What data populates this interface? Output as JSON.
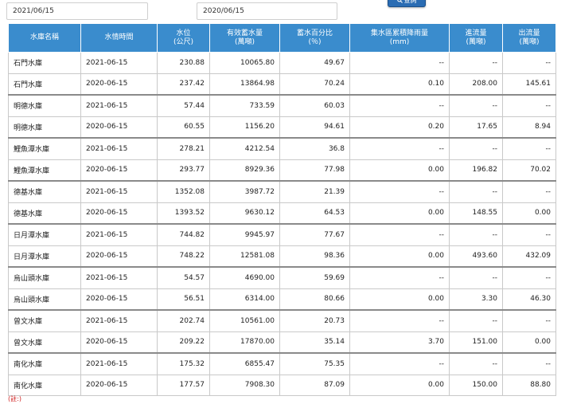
{
  "filters": {
    "date1": "2021/06/15",
    "date2": "2020/06/15"
  },
  "query_button": {
    "label": "查詢"
  },
  "table": {
    "headers": [
      [
        "水庫名稱"
      ],
      [
        "水情時間"
      ],
      [
        "水位",
        "(公尺)"
      ],
      [
        "有效蓄水量",
        "(萬噸)"
      ],
      [
        "蓄水百分比",
        "(％)"
      ],
      [
        "集水區累積降雨量",
        "(mm)"
      ],
      [
        "進流量",
        "(萬噸)"
      ],
      [
        "出流量",
        "(萬噸)"
      ]
    ],
    "rows": [
      [
        "石門水庫",
        "2021-06-15",
        "230.88",
        "10065.80",
        "49.67",
        "--",
        "--",
        "--"
      ],
      [
        "石門水庫",
        "2020-06-15",
        "237.42",
        "13864.98",
        "70.24",
        "0.10",
        "208.00",
        "145.61"
      ],
      [
        "明德水庫",
        "2021-06-15",
        "57.44",
        "733.59",
        "60.03",
        "--",
        "--",
        "--"
      ],
      [
        "明德水庫",
        "2020-06-15",
        "60.55",
        "1156.20",
        "94.61",
        "0.20",
        "17.65",
        "8.94"
      ],
      [
        "鯉魚潭水庫",
        "2021-06-15",
        "278.21",
        "4212.54",
        "36.8",
        "--",
        "--",
        "--"
      ],
      [
        "鯉魚潭水庫",
        "2020-06-15",
        "293.77",
        "8929.36",
        "77.98",
        "0.00",
        "196.82",
        "70.02"
      ],
      [
        "德基水庫",
        "2021-06-15",
        "1352.08",
        "3987.72",
        "21.39",
        "--",
        "--",
        "--"
      ],
      [
        "德基水庫",
        "2020-06-15",
        "1393.52",
        "9630.12",
        "64.53",
        "0.00",
        "148.55",
        "0.00"
      ],
      [
        "日月潭水庫",
        "2021-06-15",
        "744.82",
        "9945.97",
        "77.67",
        "--",
        "--",
        "--"
      ],
      [
        "日月潭水庫",
        "2020-06-15",
        "748.22",
        "12581.08",
        "98.36",
        "0.00",
        "493.60",
        "432.09"
      ],
      [
        "烏山頭水庫",
        "2021-06-15",
        "54.57",
        "4690.00",
        "59.69",
        "--",
        "--",
        "--"
      ],
      [
        "烏山頭水庫",
        "2020-06-15",
        "56.51",
        "6314.00",
        "80.66",
        "0.00",
        "3.30",
        "46.30"
      ],
      [
        "曾文水庫",
        "2021-06-15",
        "202.74",
        "10561.00",
        "20.73",
        "--",
        "--",
        "--"
      ],
      [
        "曾文水庫",
        "2020-06-15",
        "209.22",
        "17870.00",
        "35.14",
        "3.70",
        "151.00",
        "0.00"
      ],
      [
        "南化水庫",
        "2021-06-15",
        "175.32",
        "6855.47",
        "75.35",
        "--",
        "--",
        "--"
      ],
      [
        "南化水庫",
        "2020-06-15",
        "177.57",
        "7908.30",
        "87.09",
        "0.00",
        "150.00",
        "88.80"
      ]
    ]
  },
  "footnote": "(註:)"
}
